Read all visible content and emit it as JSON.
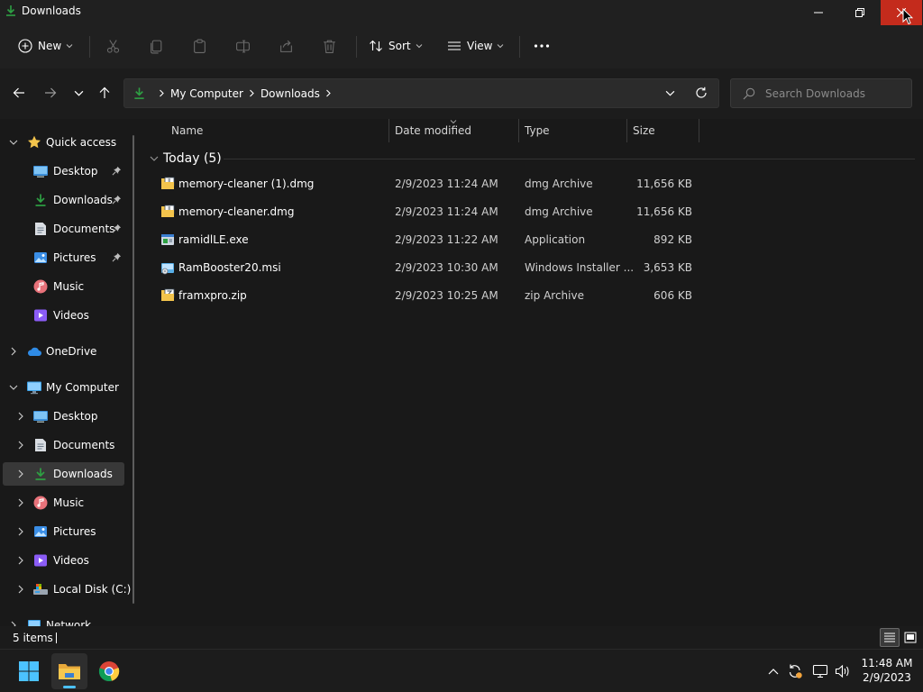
{
  "window": {
    "title": "Downloads"
  },
  "toolbar": {
    "new_label": "New",
    "sort_label": "Sort",
    "view_label": "View"
  },
  "address": {
    "crumbs": [
      "My Computer",
      "Downloads"
    ]
  },
  "search": {
    "placeholder": "Search Downloads"
  },
  "sidebar": {
    "items": [
      {
        "label": "Quick access",
        "icon": "star-icon"
      },
      {
        "label": "Desktop",
        "icon": "desktop-icon",
        "pinned": true
      },
      {
        "label": "Downloads",
        "icon": "download-icon",
        "pinned": true
      },
      {
        "label": "Documents",
        "icon": "document-icon",
        "pinned": true
      },
      {
        "label": "Pictures",
        "icon": "pictures-icon",
        "pinned": true
      },
      {
        "label": "Music",
        "icon": "music-icon"
      },
      {
        "label": "Videos",
        "icon": "videos-icon"
      },
      {
        "label": "OneDrive",
        "icon": "cloud-icon"
      },
      {
        "label": "My Computer",
        "icon": "monitor-icon"
      },
      {
        "label": "Desktop",
        "icon": "desktop-icon"
      },
      {
        "label": "Documents",
        "icon": "document-icon"
      },
      {
        "label": "Downloads",
        "icon": "download-icon",
        "selected": true
      },
      {
        "label": "Music",
        "icon": "music-icon"
      },
      {
        "label": "Pictures",
        "icon": "pictures-icon"
      },
      {
        "label": "Videos",
        "icon": "videos-icon"
      },
      {
        "label": "Local Disk (C:)",
        "icon": "drive-icon"
      },
      {
        "label": "Network",
        "icon": "network-icon"
      }
    ]
  },
  "columns": {
    "name": "Name",
    "date": "Date modified",
    "type": "Type",
    "size": "Size"
  },
  "group": {
    "label": "Today (5)"
  },
  "files": [
    {
      "name": "memory-cleaner (1).dmg",
      "date": "2/9/2023 11:24 AM",
      "type": "dmg Archive",
      "size": "11,656 KB",
      "icon": "archive-icon"
    },
    {
      "name": "memory-cleaner.dmg",
      "date": "2/9/2023 11:24 AM",
      "type": "dmg Archive",
      "size": "11,656 KB",
      "icon": "archive-icon"
    },
    {
      "name": "ramidlLE.exe",
      "date": "2/9/2023 11:22 AM",
      "type": "Application",
      "size": "892 KB",
      "icon": "application-icon"
    },
    {
      "name": "RamBooster20.msi",
      "date": "2/9/2023 10:30 AM",
      "type": "Windows Installer ...",
      "size": "3,653 KB",
      "icon": "installer-icon"
    },
    {
      "name": "framxpro.zip",
      "date": "2/9/2023 10:25 AM",
      "type": "zip Archive",
      "size": "606 KB",
      "icon": "zip-icon"
    }
  ],
  "status": {
    "count": "5 items"
  },
  "clock": {
    "time": "11:48 AM",
    "date": "2/9/2023"
  },
  "colors": {
    "accent": "#4cc2ff",
    "close_hover": "#c42b1c",
    "download_green": "#2ea043",
    "folder_yellow": "#f3c44c"
  }
}
